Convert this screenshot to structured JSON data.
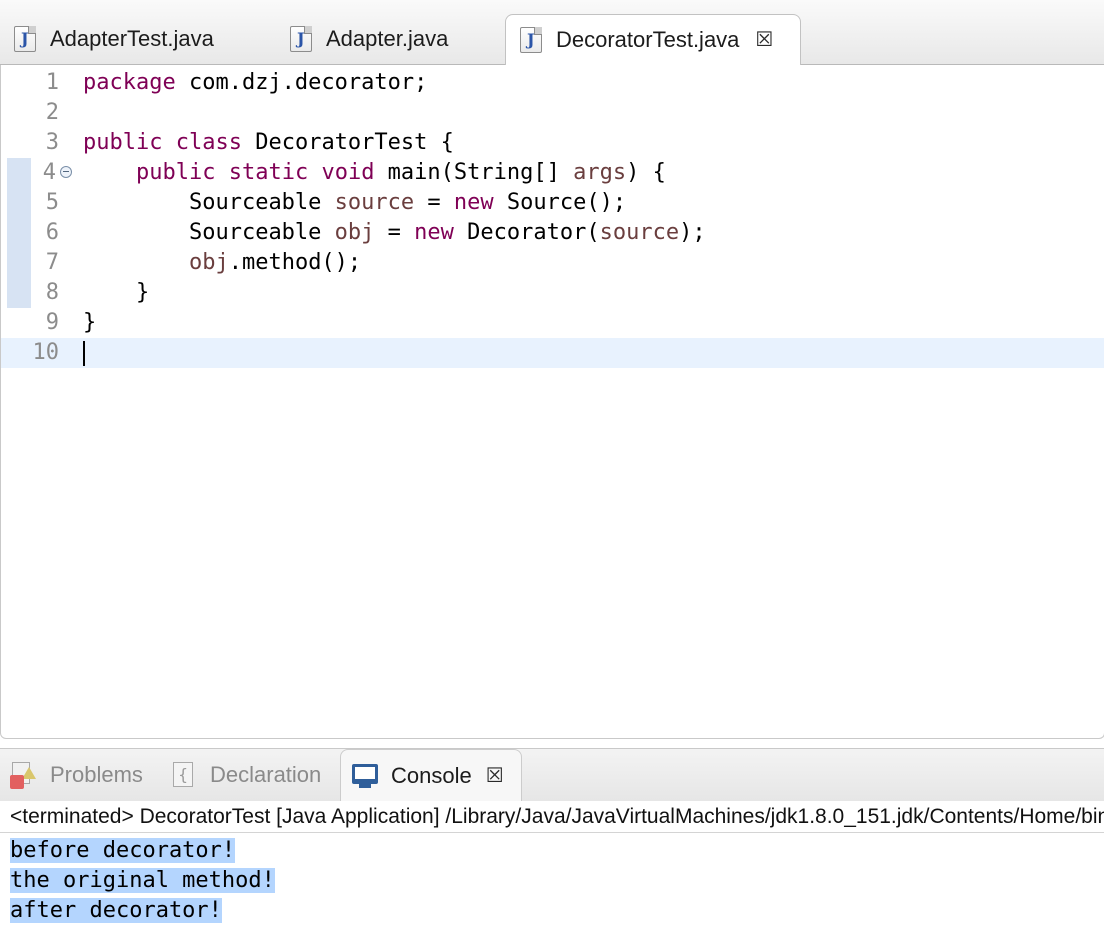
{
  "editor_tabs": [
    {
      "label": "AdapterTest.java",
      "icon": "java-file-icon",
      "active": false
    },
    {
      "label": "Adapter.java",
      "icon": "java-file-icon",
      "active": false
    },
    {
      "label": "DecoratorTest.java",
      "icon": "java-file-icon",
      "active": true,
      "close_glyph": "☒"
    }
  ],
  "editor": {
    "line_numbers": [
      "1",
      "2",
      "3",
      "4",
      "5",
      "6",
      "7",
      "8",
      "9",
      "10"
    ],
    "current_line": "10",
    "tokens": {
      "package": "package",
      "package_name": " com.dzj.decorator;",
      "public": "public",
      "class": "class",
      "class_name": " DecoratorTest {",
      "static": "static",
      "void": "void",
      "main_sig_a": " main(String[] ",
      "args": "args",
      "main_sig_b": ") {",
      "sourceable_1": "Sourceable ",
      "source_var": "source",
      "eq_1": " = ",
      "new": "new",
      "source_ctor": " Source();",
      "sourceable_2": "Sourceable ",
      "obj_var": "obj",
      "eq_2": " = ",
      "decorator_ctor": " Decorator(",
      "source_arg": "source",
      "close_call": ");",
      "obj_call_var": "obj",
      "method_call": ".method();",
      "close_brace": "}"
    },
    "colors": {
      "keyword": "#7f0055",
      "local_variable": "#6a3e3e"
    }
  },
  "views": {
    "tabs": [
      {
        "label": "Problems",
        "icon": "problems-icon",
        "active": false
      },
      {
        "label": "Declaration",
        "icon": "declaration-icon",
        "active": false
      },
      {
        "label": "Console",
        "icon": "console-icon",
        "active": true,
        "close_glyph": "☒"
      }
    ]
  },
  "console": {
    "header": "<terminated> DecoratorTest [Java Application] /Library/Java/JavaVirtualMachines/jdk1.8.0_151.jdk/Contents/Home/bin/java",
    "output": [
      "before decorator!",
      "the original method!",
      "after decorator!"
    ],
    "selection_color": "#b4d5fe"
  }
}
